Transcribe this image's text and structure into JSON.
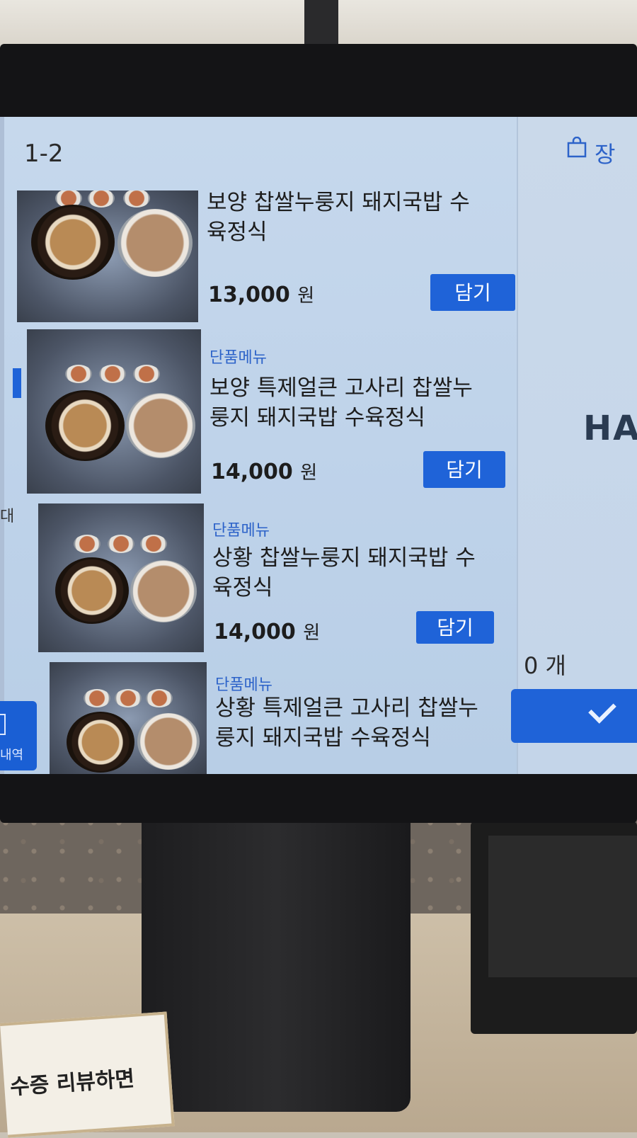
{
  "page_indicator": "1-2",
  "menu_items": [
    {
      "category": "",
      "name_line1": "보양 찹쌀누룽지 돼지국밥 수",
      "name_line2": "육정식",
      "price": "13,000",
      "currency": "원",
      "add_label": "담기"
    },
    {
      "category": "단품메뉴",
      "name_line1": "보양 특제얼큰 고사리 찹쌀누",
      "name_line2": "룽지 돼지국밥 수육정식",
      "price": "14,000",
      "currency": "원",
      "add_label": "담기"
    },
    {
      "category": "단품메뉴",
      "name_line1": "상황 찹쌀누룽지 돼지국밥 수",
      "name_line2": "육정식",
      "price": "14,000",
      "currency": "원",
      "add_label": "담기"
    },
    {
      "category": "단품메뉴",
      "name_line1": "상황 특제얼큰 고사리 찹쌀누",
      "name_line2": "룽지 돼지국밥 수육정식"
    }
  ],
  "left_sidebar": {
    "partial_label": "대",
    "history_button_label": "내역"
  },
  "cart": {
    "label_partial": "장",
    "count": "0 개",
    "brand_partial": "HA"
  },
  "scene": {
    "note_text": "수증 리뷰하면"
  },
  "colors": {
    "accent": "#1f63d8",
    "category_text": "#2d63c9",
    "screen_bg": "#c6d8ec"
  }
}
